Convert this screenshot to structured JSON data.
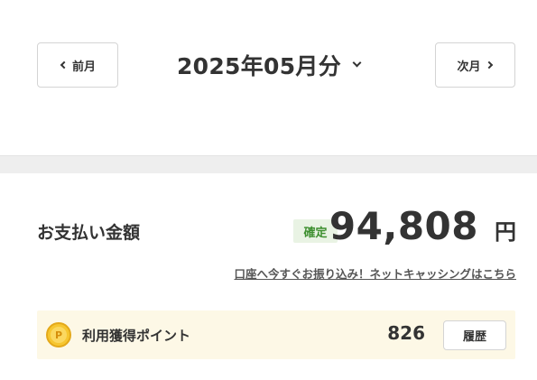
{
  "month_nav": {
    "prev_label": "前月",
    "current_month": "2025年05月分",
    "next_label": "次月"
  },
  "payment": {
    "label": "お支払い金額",
    "status": "確定",
    "amount": "94,808",
    "currency": "円",
    "transfer_link": "口座へ今すぐお振り込み！ネットキャッシングはこちら"
  },
  "points": {
    "icon_glyph": "P",
    "label": "利用獲得ポイント",
    "value": "826",
    "history_label": "履歴"
  },
  "colors": {
    "status_badge_bg": "#e9f3e4",
    "status_badge_text": "#3d8f2f",
    "points_row_bg": "#fdf8e6",
    "coin": "#f6c630",
    "divider_band": "#eeeeee"
  },
  "icons": {
    "prev": "chevron-left-icon",
    "next": "chevron-right-icon",
    "month_dropdown": "chevron-down-icon",
    "points": "point-coin-icon"
  }
}
